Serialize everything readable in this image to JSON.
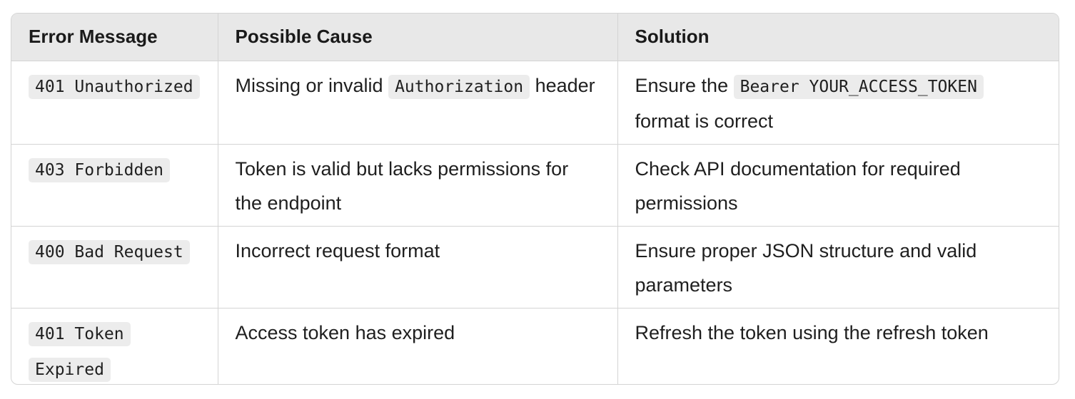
{
  "table": {
    "headers": [
      "Error Message",
      "Possible Cause",
      "Solution"
    ],
    "rows": [
      {
        "error": "401 Unauthorized",
        "cause_before": "Missing or invalid ",
        "cause_code": "Authorization",
        "cause_after": " header",
        "solution_before": "Ensure the ",
        "solution_code": "Bearer YOUR_ACCESS_TOKEN",
        "solution_after": " format is correct"
      },
      {
        "error": "403 Forbidden",
        "cause": "Token is valid but lacks permissions for the endpoint",
        "solution": "Check API documentation for required permissions"
      },
      {
        "error": "400 Bad Request",
        "cause": "Incorrect request format",
        "solution": "Ensure proper JSON structure and valid parameters"
      },
      {
        "error": "401 Token Expired",
        "cause": "Access token has expired",
        "solution": "Refresh the token using the refresh token"
      }
    ]
  }
}
